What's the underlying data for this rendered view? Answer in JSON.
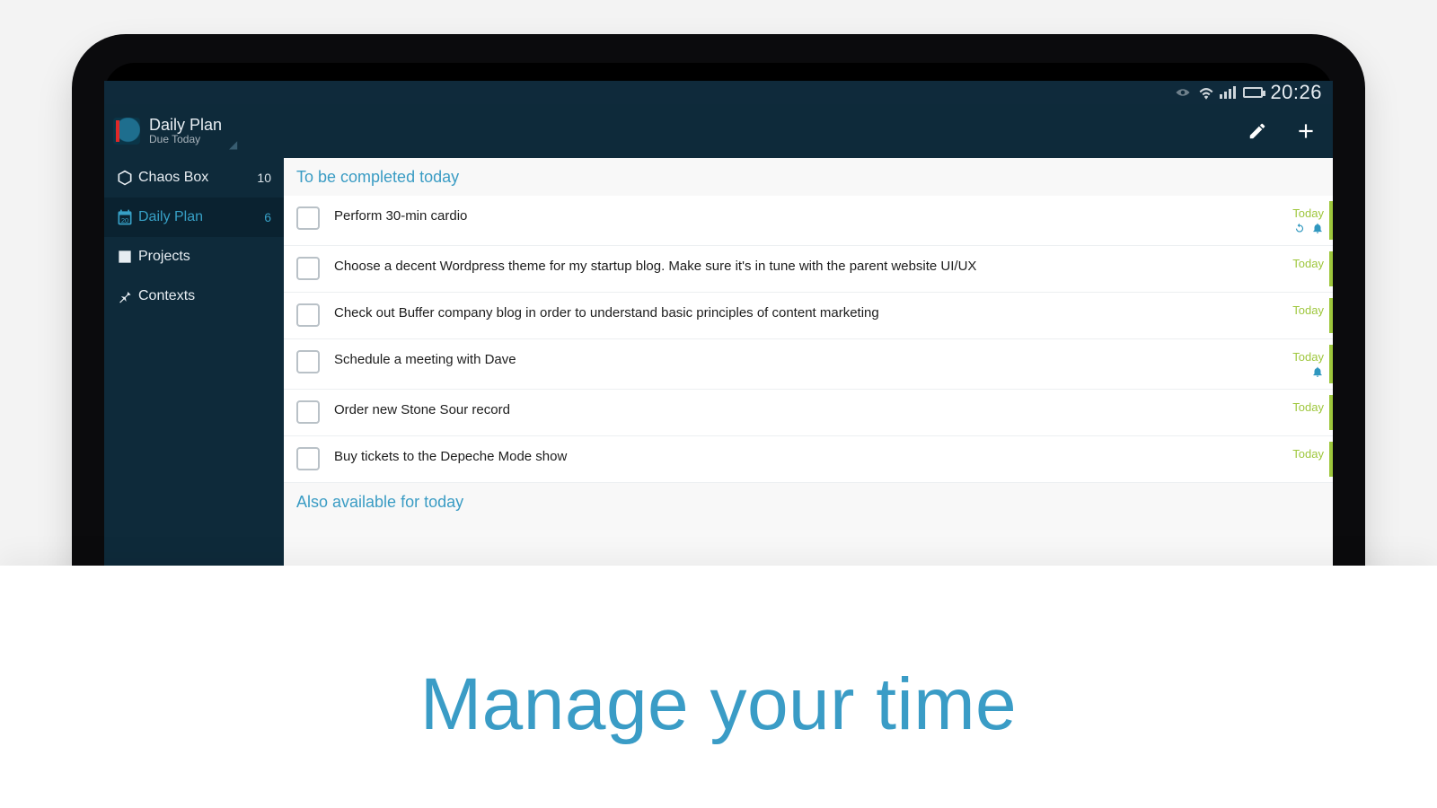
{
  "statusbar": {
    "time": "20:26"
  },
  "header": {
    "title": "Daily Plan",
    "subtitle": "Due Today"
  },
  "sidebar": {
    "items": [
      {
        "label": "Chaos Box",
        "count": "10"
      },
      {
        "label": "Daily Plan",
        "count": "6"
      },
      {
        "label": "Projects",
        "count": ""
      },
      {
        "label": "Contexts",
        "count": ""
      }
    ]
  },
  "content": {
    "section1_title": "To be completed today",
    "section2_title": "Also available for today",
    "tasks": [
      {
        "text": "Perform 30-min cardio",
        "due": "Today",
        "repeat": true,
        "alarm": true
      },
      {
        "text": "Choose a decent Wordpress theme for my startup blog. Make sure it's in tune with the parent website UI/UX",
        "due": "Today",
        "repeat": false,
        "alarm": false
      },
      {
        "text": "Check out Buffer company blog in order to understand basic principles of content marketing",
        "due": "Today",
        "repeat": false,
        "alarm": false
      },
      {
        "text": "Schedule a meeting with Dave",
        "due": "Today",
        "repeat": false,
        "alarm": true
      },
      {
        "text": "Order new Stone Sour record",
        "due": "Today",
        "repeat": false,
        "alarm": false
      },
      {
        "text": "Buy tickets to the Depeche Mode show",
        "due": "Today",
        "repeat": false,
        "alarm": false
      }
    ]
  },
  "caption": "Manage your time"
}
